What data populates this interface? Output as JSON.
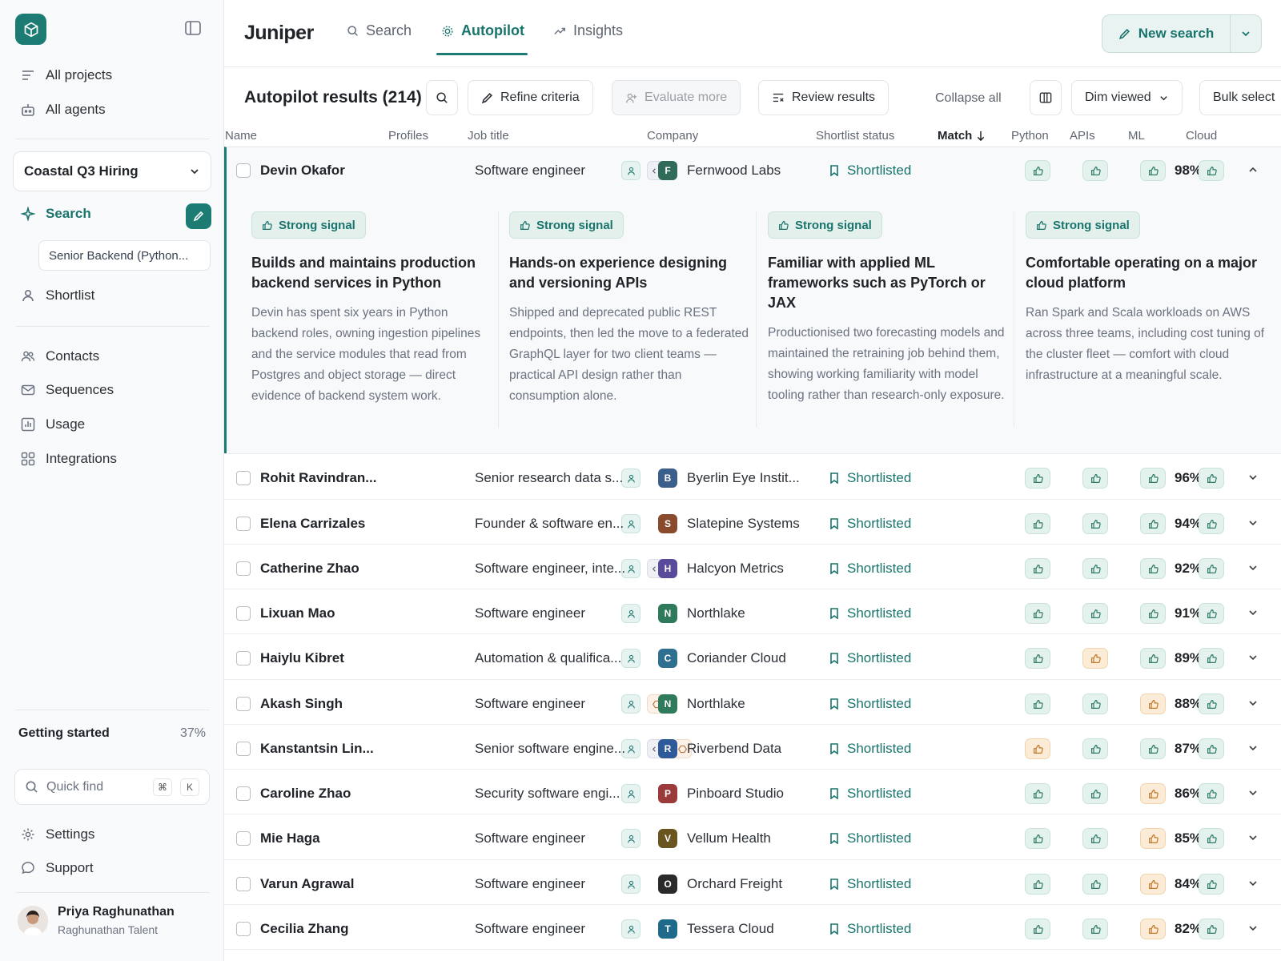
{
  "sidebar": {
    "nav_top": [
      {
        "label": "All projects",
        "icon": "list-icon"
      },
      {
        "label": "All agents",
        "icon": "bot-icon"
      }
    ],
    "project": "Coastal Q3 Hiring",
    "search_label": "Search",
    "search_sub": "Senior Backend (Python...",
    "shortlist_label": "Shortlist",
    "nav_bottom": [
      {
        "label": "Contacts",
        "icon": "contacts-icon"
      },
      {
        "label": "Sequences",
        "icon": "mail-icon"
      },
      {
        "label": "Usage",
        "icon": "chart-icon"
      },
      {
        "label": "Integrations",
        "icon": "grid-icon"
      }
    ],
    "getting_started": {
      "label": "Getting started",
      "percent": "37%"
    },
    "quick_find": {
      "placeholder": "Quick find",
      "key1": "⌘",
      "key2": "K"
    },
    "settings_label": "Settings",
    "support_label": "Support",
    "user": {
      "name": "Priya Raghunathan",
      "org": "Raghunathan Talent"
    }
  },
  "topbar": {
    "brand": "Juniper",
    "tabs": [
      {
        "label": "Search",
        "icon": "search-icon"
      },
      {
        "label": "Autopilot",
        "icon": "autopilot-icon",
        "active": true
      },
      {
        "label": "Insights",
        "icon": "trend-icon"
      }
    ],
    "new_search_label": "New search"
  },
  "toolbar": {
    "title": "Autopilot results (214)",
    "refine": "Refine criteria",
    "evaluate": "Evaluate more",
    "review": "Review results",
    "collapse": "Collapse all",
    "dim_viewed": "Dim viewed",
    "bulk_select": "Bulk select"
  },
  "columns": {
    "name": "Name",
    "profiles": "Profiles",
    "job": "Job title",
    "company": "Company",
    "status": "Shortlist status",
    "match": "Match",
    "python": "Python",
    "apis": "APIs",
    "ml": "ML",
    "cloud": "Cloud"
  },
  "expanded": {
    "signals": [
      {
        "badge": "Strong signal",
        "title": "Builds and maintains production backend services in Python",
        "body": "Devin has spent six years in Python backend roles, owning ingestion pipelines and the service modules that read from Postgres and object storage — direct evidence of backend system work."
      },
      {
        "badge": "Strong signal",
        "title": "Hands-on experience designing and versioning APIs",
        "body": "Shipped and deprecated public REST endpoints, then led the move to a federated GraphQL layer for two client teams — practical API design rather than consumption alone."
      },
      {
        "badge": "Strong signal",
        "title": "Familiar with applied ML frameworks such as PyTorch or JAX",
        "body": "Productionised two forecasting models and maintained the retraining job behind them, showing working familiarity with model tooling rather than research-only exposure."
      },
      {
        "badge": "Strong signal",
        "title": "Comfortable operating on a major cloud platform",
        "body": "Ran Spark and Scala workloads on AWS across three teams, including cost tuning of the cluster fleet — comfort with cloud infrastructure at a meaningful scale."
      }
    ]
  },
  "rows": [
    {
      "name": "Devin Okafor",
      "profiles": [
        "user",
        "code"
      ],
      "job": "Software engineer",
      "company": "Fernwood Labs",
      "letter": "F",
      "color": "#2f6b58",
      "status": "Shortlisted",
      "match": "98%",
      "signals": [
        "g",
        "g",
        "g",
        "g"
      ]
    },
    {
      "name": "Rohit Ravindran...",
      "profiles": [
        "user"
      ],
      "job": "Senior research data s...",
      "company": "Byerlin Eye Instit...",
      "letter": "B",
      "color": "#3a5f8a",
      "status": "Shortlisted",
      "match": "96%",
      "signals": [
        "g",
        "g",
        "g",
        "g"
      ]
    },
    {
      "name": "Elena Carrizales",
      "profiles": [
        "user"
      ],
      "job": "Founder & software en...",
      "company": "Slatepine Systems",
      "letter": "S",
      "color": "#8a4b2c",
      "status": "Shortlisted",
      "match": "94%",
      "signals": [
        "g",
        "g",
        "g",
        "g"
      ]
    },
    {
      "name": "Catherine Zhao",
      "profiles": [
        "user",
        "code"
      ],
      "job": "Software engineer, inte...",
      "company": "Halcyon Metrics",
      "letter": "H",
      "color": "#5a4a9a",
      "status": "Shortlisted",
      "match": "92%",
      "signals": [
        "g",
        "g",
        "g",
        "g"
      ]
    },
    {
      "name": "Lixuan Mao",
      "profiles": [
        "user"
      ],
      "job": "Software engineer",
      "company": "Northlake",
      "letter": "N",
      "color": "#2f7a5a",
      "status": "Shortlisted",
      "match": "91%",
      "signals": [
        "g",
        "g",
        "g",
        "g"
      ]
    },
    {
      "name": "Haiylu Kibret",
      "profiles": [
        "user"
      ],
      "job": "Automation & qualifica...",
      "company": "Coriander Cloud",
      "letter": "C",
      "color": "#2f6f8f",
      "status": "Shortlisted",
      "match": "89%",
      "signals": [
        "g",
        "o",
        "g",
        "g"
      ]
    },
    {
      "name": "Akash Singh",
      "profiles": [
        "user",
        "hex"
      ],
      "job": "Software engineer",
      "company": "Northlake",
      "letter": "N",
      "color": "#2f7a5a",
      "status": "Shortlisted",
      "match": "88%",
      "signals": [
        "g",
        "g",
        "o",
        "g"
      ]
    },
    {
      "name": "Kanstantsin Lin...",
      "profiles": [
        "user",
        "code",
        "hex"
      ],
      "job": "Senior software engine...",
      "company": "Riverbend Data",
      "letter": "R",
      "color": "#2f5a9a",
      "status": "Shortlisted",
      "match": "87%",
      "signals": [
        "o",
        "g",
        "g",
        "g"
      ]
    },
    {
      "name": "Caroline Zhao",
      "profiles": [
        "user"
      ],
      "job": "Security software engi...",
      "company": "Pinboard Studio",
      "letter": "P",
      "color": "#9a3a3a",
      "status": "Shortlisted",
      "match": "86%",
      "signals": [
        "g",
        "g",
        "o",
        "g"
      ]
    },
    {
      "name": "Mie Haga",
      "profiles": [
        "user"
      ],
      "job": "Software engineer",
      "company": "Vellum Health",
      "letter": "V",
      "color": "#6a5520",
      "status": "Shortlisted",
      "match": "85%",
      "signals": [
        "g",
        "g",
        "o",
        "g"
      ]
    },
    {
      "name": "Varun Agrawal",
      "profiles": [
        "user"
      ],
      "job": "Software engineer",
      "company": "Orchard Freight",
      "letter": "O",
      "color": "#2a2a2a",
      "status": "Shortlisted",
      "match": "84%",
      "signals": [
        "g",
        "g",
        "o",
        "g"
      ]
    },
    {
      "name": "Cecilia Zhang",
      "profiles": [
        "user"
      ],
      "job": "Software engineer",
      "company": "Tessera Cloud",
      "letter": "T",
      "color": "#1f6a8a",
      "status": "Shortlisted",
      "match": "82%",
      "signals": [
        "g",
        "g",
        "o",
        "g"
      ]
    }
  ]
}
